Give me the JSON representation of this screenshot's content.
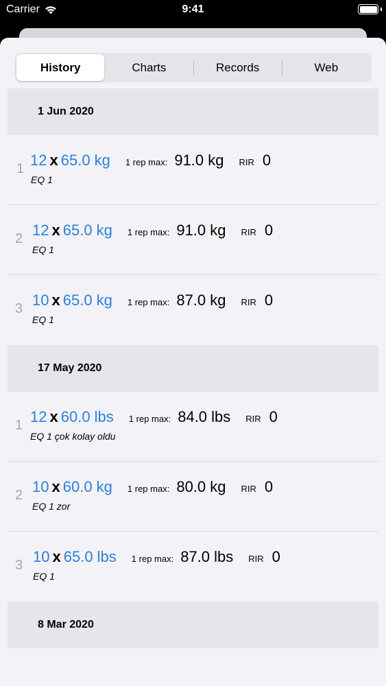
{
  "status": {
    "carrier": "Carrier",
    "time": "9:41"
  },
  "tabs": [
    {
      "label": "History",
      "active": true
    },
    {
      "label": "Charts",
      "active": false
    },
    {
      "label": "Records",
      "active": false
    },
    {
      "label": "Web",
      "active": false
    }
  ],
  "sections": [
    {
      "date": "1 Jun 2020",
      "rows": [
        {
          "index": "1",
          "reps": "12",
          "x": "x",
          "weight": "65.0 kg",
          "onerm_label": "1 rep max:",
          "onerm": "91.0 kg",
          "rir_label": "RIR",
          "rir": "0",
          "note": "EQ 1"
        },
        {
          "index": "2",
          "reps": "12",
          "x": "x",
          "weight": "65.0 kg",
          "onerm_label": "1 rep max:",
          "onerm": "91.0 kg",
          "rir_label": "RIR",
          "rir": "0",
          "note": "EQ 1"
        },
        {
          "index": "3",
          "reps": "10",
          "x": "x",
          "weight": "65.0 kg",
          "onerm_label": "1 rep max:",
          "onerm": "87.0 kg",
          "rir_label": "RIR",
          "rir": "0",
          "note": "EQ 1"
        }
      ]
    },
    {
      "date": "17 May 2020",
      "rows": [
        {
          "index": "1",
          "reps": "12",
          "x": "x",
          "weight": "60.0 lbs",
          "onerm_label": "1 rep max:",
          "onerm": "84.0 lbs",
          "rir_label": "RIR",
          "rir": "0",
          "note": "EQ 1 çok kolay oldu"
        },
        {
          "index": "2",
          "reps": "10",
          "x": "x",
          "weight": "60.0 kg",
          "onerm_label": "1 rep max:",
          "onerm": "80.0 kg",
          "rir_label": "RIR",
          "rir": "0",
          "note": "EQ 1 zor"
        },
        {
          "index": "3",
          "reps": "10",
          "x": "x",
          "weight": "65.0 lbs",
          "onerm_label": "1 rep max:",
          "onerm": "87.0 lbs",
          "rir_label": "RIR",
          "rir": "0",
          "note": "EQ 1"
        }
      ]
    },
    {
      "date": "8 Mar 2020",
      "rows": []
    }
  ],
  "colors": {
    "accent": "#2f7ed8",
    "index_gray": "#a5a5aa",
    "header_bg": "#e5e5ea",
    "background": "#f2f2f7"
  },
  "icons": {
    "wifi": "wifi-icon",
    "battery": "battery-icon"
  }
}
